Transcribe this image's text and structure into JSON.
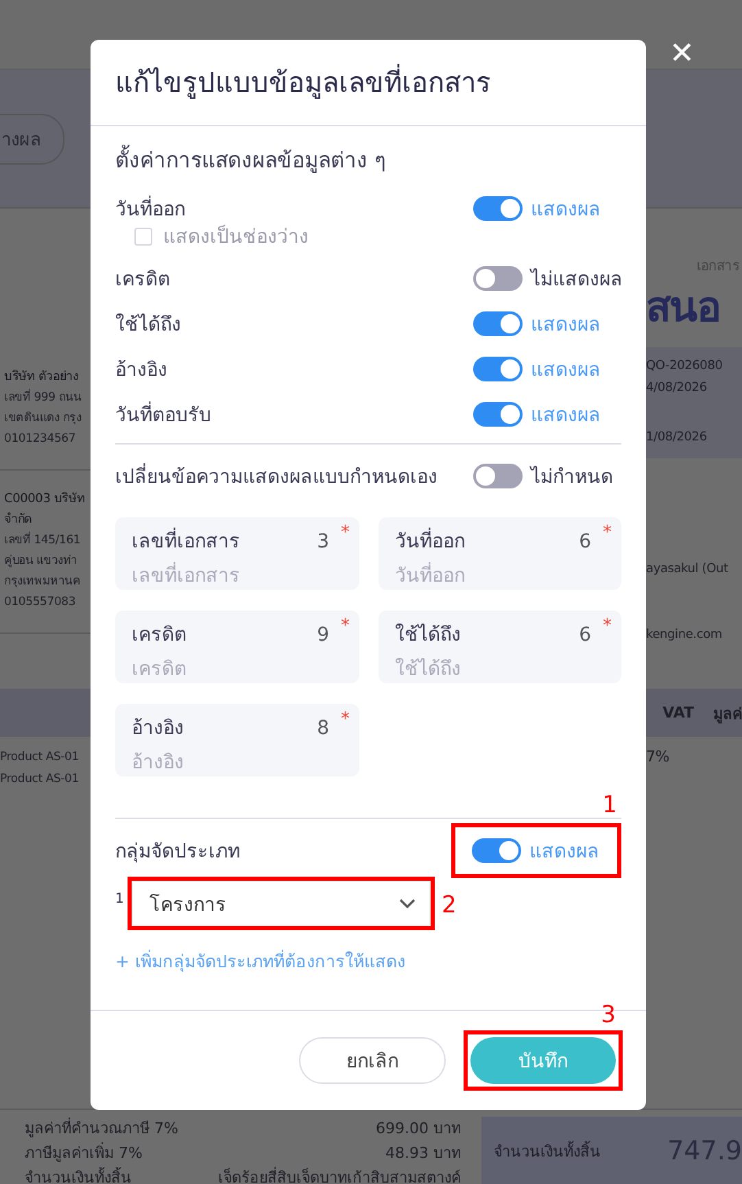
{
  "background": {
    "filter_pill": "างผล",
    "customers": [
      {
        "name_lines": [
          "บริษัท ตัวอย่าง"
        ],
        "lines": [
          "เลขที่ 999 ถนน",
          "เขตดินแดง กรุง",
          "0101234567"
        ]
      },
      {
        "name_lines": [
          "C00003 บริษัท",
          "จำกัด"
        ],
        "lines": [
          "เลขที่ 145/161",
          "คู่บอน  แขวงท่า",
          "กรุงเทพมหานค",
          "0105557083"
        ]
      }
    ],
    "doc_label": "เอกสาร",
    "doc_title": "สนอ",
    "doc_info": [
      "QO-2026080",
      "4/08/2026",
      "1/08/2026"
    ],
    "contact": "ayasakul (Out",
    "email": "kengine.com",
    "table": {
      "columns": [
        "VAT",
        "มูลค่"
      ],
      "rows": [
        {
          "name": "Product AS-01",
          "description": "Product AS-01",
          "vat": "7%"
        }
      ]
    },
    "summary": {
      "rows": [
        {
          "label": "มูลค่าที่คำนวณภาษี 7%",
          "value": "699.00 บาท"
        },
        {
          "label": "ภาษีมูลค่าเพิ่ม 7%",
          "value": "48.93 บาท"
        },
        {
          "label": "จำนวนเงินทั้งสิ้น",
          "value": "เจ็ดร้อยสี่สิบเจ็ดบาทเก้าสิบสามสตางค์"
        }
      ],
      "total_label": "จำนวนเงินทั้งสิ้น",
      "total_value": "747.9"
    }
  },
  "close_icon": "✕",
  "modal": {
    "title": "แก้ไขรูปแบบข้อมูลเลขที่เอกสาร",
    "section_title": "ตั้งค่าการแสดงผลข้อมูลต่าง ๆ",
    "display_items": [
      {
        "label": "วันที่ออก",
        "on": true,
        "state_label": "แสดงผล",
        "option": {
          "label": "แสดงเป็นช่องว่าง",
          "checked": false
        }
      },
      {
        "label": "เครดิต",
        "on": false,
        "state_label": "ไม่แสดงผล"
      },
      {
        "label": "ใช้ได้ถึง",
        "on": true,
        "state_label": "แสดงผล"
      },
      {
        "label": "อ้างอิง",
        "on": true,
        "state_label": "แสดงผล"
      },
      {
        "label": "วันที่ตอบรับ",
        "on": true,
        "state_label": "แสดงผล"
      }
    ],
    "custom_text": {
      "label": "เปลี่ยนข้อความแสดงผลแบบกำหนดเอง",
      "on": false,
      "state_label": "ไม่กำหนด"
    },
    "fields": [
      {
        "label": "เลขที่เอกสาร",
        "count": "3",
        "mark": "*",
        "placeholder": "เลขที่เอกสาร"
      },
      {
        "label": "วันที่ออก",
        "count": "6",
        "mark": "*",
        "placeholder": "วันที่ออก"
      },
      {
        "label": "เครดิต",
        "count": "9",
        "mark": "*",
        "placeholder": "เครดิต"
      },
      {
        "label": "ใช้ได้ถึง",
        "count": "6",
        "mark": "*",
        "placeholder": "ใช้ได้ถึง"
      },
      {
        "label": "อ้างอิง",
        "count": "8",
        "mark": "*",
        "placeholder": "อ้างอิง"
      }
    ],
    "group": {
      "title": "กลุ่มจัดประเภท",
      "on": true,
      "state_label": "แสดงผล",
      "annotation": "1",
      "dropdowns": [
        {
          "index": "1",
          "value": "โครงการ",
          "annotation": "2"
        }
      ],
      "add_link": "+ เพิ่มกลุ่มจัดประเภทที่ต้องการให้แสดง"
    },
    "buttons": {
      "cancel": "ยกเลิก",
      "save": "บันทึก",
      "save_annotation": "3"
    }
  }
}
